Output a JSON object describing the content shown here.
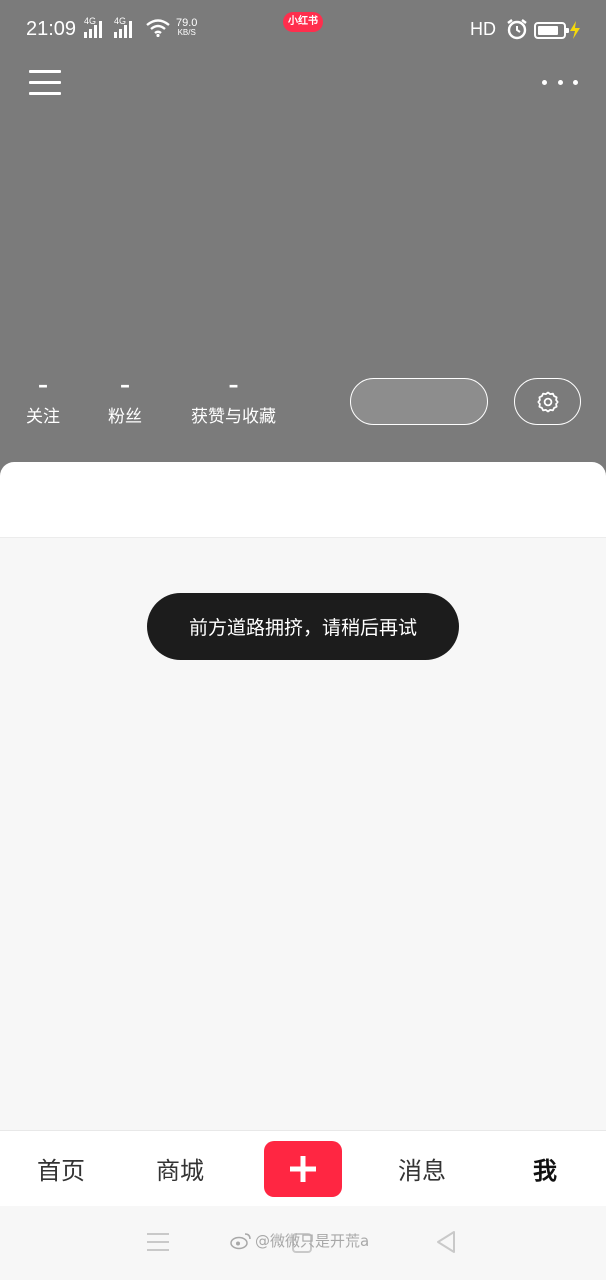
{
  "status_bar": {
    "time": "21:09",
    "signal1_tag": "4G",
    "signal2_tag": "4G",
    "net_speed_value": "79.0",
    "net_speed_unit": "KB/S",
    "app_badge": "小红书",
    "hd_label": "HD",
    "icons": [
      "signal-icon",
      "wifi-icon",
      "alarm-icon",
      "battery-icon",
      "charging-icon"
    ]
  },
  "top_nav": {
    "icons": [
      "menu-icon",
      "more-icon"
    ]
  },
  "stats": [
    {
      "value": "–",
      "label": "关注"
    },
    {
      "value": "–",
      "label": "粉丝"
    },
    {
      "value": "–",
      "label": "获赞与收藏"
    }
  ],
  "profile_actions": {
    "edit_label": "",
    "settings_icon": "gear-icon"
  },
  "toast": {
    "message": "前方道路拥挤，请稍后再试"
  },
  "bottom_nav": {
    "home": "首页",
    "mall": "商城",
    "add_icon": "plus-icon",
    "messages": "消息",
    "me": "我"
  },
  "watermark": {
    "text": "@微微只是开荒a"
  },
  "colors": {
    "header_bg": "#7b7b7b",
    "accent": "#ff2642",
    "toast_bg": "#1c1c1c",
    "page_bg": "#f7f7f7"
  }
}
